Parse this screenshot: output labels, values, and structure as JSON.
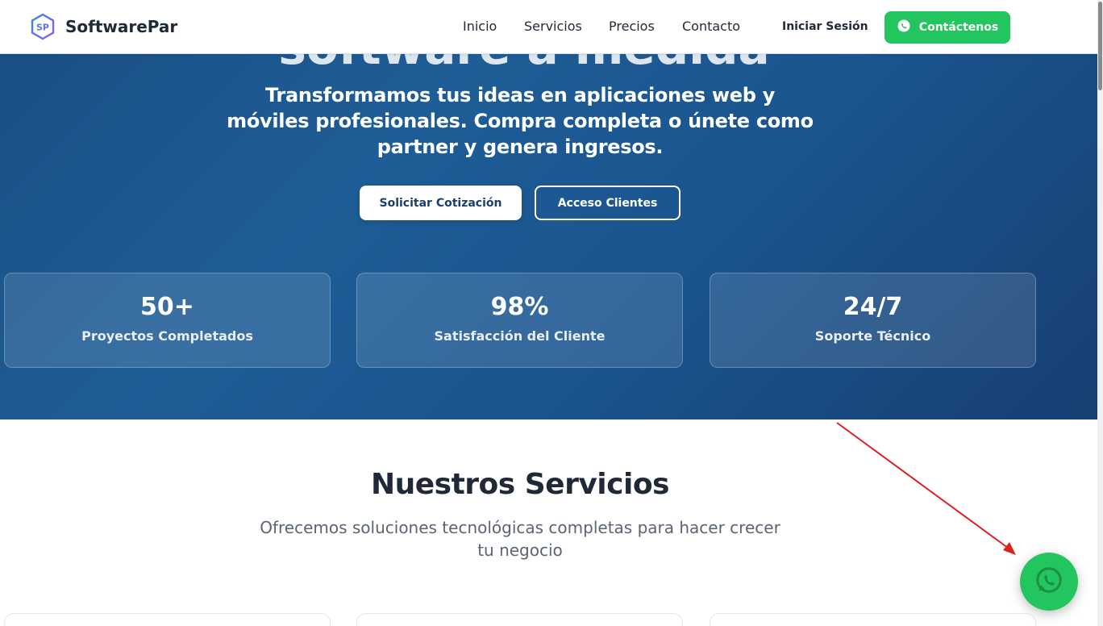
{
  "nav": {
    "brand": "SoftwarePar",
    "links": [
      "Inicio",
      "Servicios",
      "Precios",
      "Contacto"
    ],
    "login": "Iniciar Sesión",
    "contact_button": "Contáctenos"
  },
  "hero": {
    "partial_heading": "Desarrollo de software a medida",
    "subtitle": "Transformamos tus ideas en aplicaciones web y móviles profesionales. Compra completa o únete como partner y genera ingresos.",
    "primary_button": "Solicitar Cotización",
    "secondary_button": "Acceso Clientes",
    "stats": [
      {
        "value": "50+",
        "label": "Proyectos Completados"
      },
      {
        "value": "98%",
        "label": "Satisfacción del Cliente"
      },
      {
        "value": "24/7",
        "label": "Soporte Técnico"
      }
    ]
  },
  "services": {
    "title": "Nuestros Servicios",
    "subtitle_line1": "Ofrecemos soluciones tecnológicas completas para hacer crecer",
    "subtitle_line2": "tu negocio"
  },
  "colors": {
    "hero_bg": "#1e5d97",
    "accent_green": "#22c55e",
    "annotation_arrow": "#e11d1d"
  },
  "icons": {
    "logo": "sp-hexagon-logo-icon",
    "contact": "whatsapp-icon",
    "floating": "whatsapp-icon"
  }
}
